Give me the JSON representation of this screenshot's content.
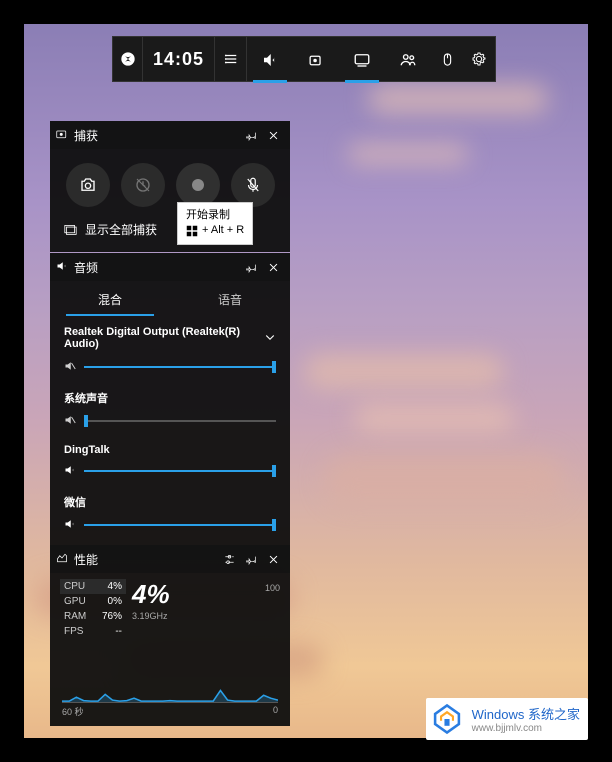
{
  "toolbar": {
    "time": "14:05"
  },
  "capture": {
    "title": "捕获",
    "show_all": "显示全部捕获"
  },
  "tooltip": {
    "line1": "开始录制",
    "shortcut": "+ Alt + R"
  },
  "audio": {
    "title": "音频",
    "tabs": {
      "mix": "混合",
      "voice": "语音"
    },
    "device": "Realtek Digital Output (Realtek(R) Audio)",
    "sources": {
      "system": {
        "label": "系统声音",
        "value": 0,
        "muted": true
      },
      "dingtalk": {
        "label": "DingTalk",
        "value": 100,
        "muted": false
      },
      "wechat": {
        "label": "微信",
        "value": 100,
        "muted": false
      }
    },
    "device_value": 100,
    "device_muted": true
  },
  "perf": {
    "title": "性能",
    "rows": {
      "cpu": {
        "lbl": "CPU",
        "val": "4%"
      },
      "gpu": {
        "lbl": "GPU",
        "val": "0%"
      },
      "ram": {
        "lbl": "RAM",
        "val": "76%"
      },
      "fps": {
        "lbl": "FPS",
        "val": "--"
      }
    },
    "big": "4%",
    "clock": "3.19GHz",
    "scale_top": "100",
    "scale_bottom": "0",
    "time_label": "60 秒"
  },
  "watermark": {
    "title": "Windows 系统之家",
    "url": "www.bjjmlv.com"
  },
  "chart_data": {
    "type": "line",
    "title": "CPU usage",
    "xlabel": "60 秒",
    "ylabel": "",
    "ylim": [
      0,
      100
    ],
    "x": [
      0,
      2,
      4,
      6,
      8,
      10,
      12,
      14,
      16,
      18,
      20,
      22,
      24,
      26,
      28,
      30,
      32,
      34,
      36,
      38,
      40,
      42,
      44,
      46,
      48,
      50,
      52,
      54,
      56,
      58,
      60
    ],
    "values": [
      4,
      4,
      12,
      5,
      4,
      4,
      18,
      6,
      4,
      5,
      10,
      4,
      4,
      4,
      4,
      5,
      4,
      4,
      4,
      4,
      4,
      4,
      26,
      6,
      4,
      4,
      4,
      4,
      16,
      10,
      6
    ]
  }
}
